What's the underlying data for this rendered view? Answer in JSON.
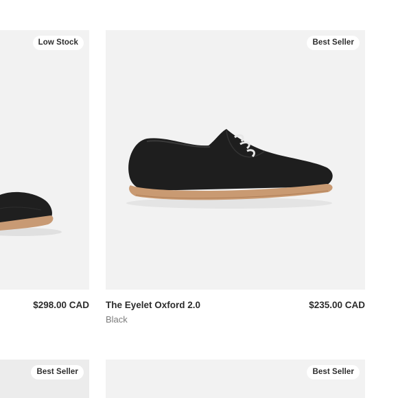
{
  "products": [
    {
      "badge": "Low Stock",
      "price": "$298.00 CAD"
    },
    {
      "badge": "Best Seller",
      "title": "The Eyelet Oxford 2.0",
      "variant": "Black",
      "price": "$235.00 CAD"
    },
    {
      "badge": "Best Seller"
    },
    {
      "badge": "Best Seller"
    }
  ],
  "colors": {
    "card_background": "#f2f2f2",
    "badge_background": "#ffffff",
    "text_primary": "#2b2b2b",
    "text_secondary": "#7b7b7b"
  }
}
